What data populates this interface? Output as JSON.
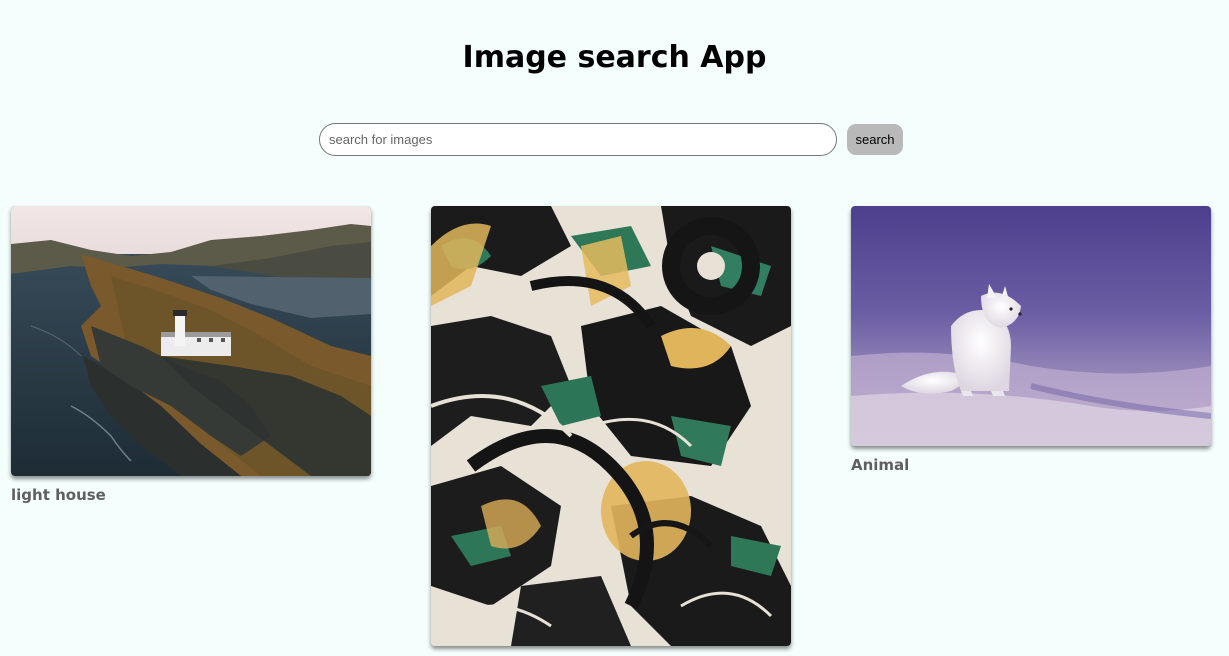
{
  "header": {
    "title": "Image search App"
  },
  "search": {
    "placeholder": "search for images",
    "value": "",
    "button_label": "search"
  },
  "results": [
    {
      "caption": "light house"
    },
    {
      "caption": ""
    },
    {
      "caption": "Animal"
    }
  ]
}
